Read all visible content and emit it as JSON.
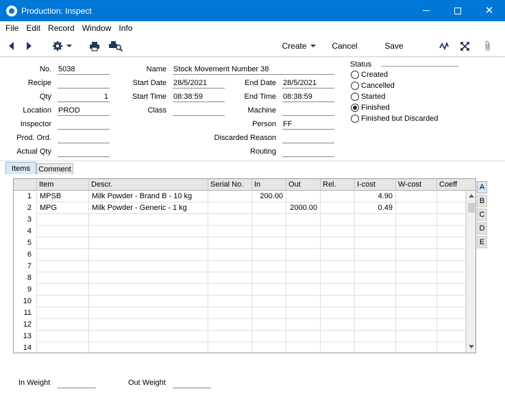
{
  "window": {
    "title": "Production: Inspect"
  },
  "menu": [
    "File",
    "Edit",
    "Record",
    "Window",
    "Info"
  ],
  "toolbar": {
    "create_label": "Create",
    "cancel_label": "Cancel",
    "save_label": "Save"
  },
  "header": {
    "labels": {
      "no": "No.",
      "recipe": "Recipe",
      "qty": "Qty",
      "location": "Location",
      "inspector": "Inspector",
      "prod_ord": "Prod. Ord.",
      "actual_qty": "Actual Qty",
      "name": "Name",
      "start_date": "Start Date",
      "start_time": "Start Time",
      "class": "Class",
      "end_date": "End Date",
      "end_time": "End Time",
      "machine": "Machine",
      "person": "Person",
      "discarded_reason": "Discarded Reason",
      "routing": "Routing",
      "status": "Status"
    },
    "values": {
      "no": "5038",
      "recipe": "",
      "qty": "1",
      "location": "PROD",
      "inspector": "",
      "prod_ord": "",
      "actual_qty": "",
      "name": "Stock Movement Number 38",
      "start_date": "28/5/2021",
      "start_time": "08:38:59",
      "class": "",
      "end_date": "28/5/2021",
      "end_time": "08:38:59",
      "machine": "",
      "person": "FF",
      "discarded_reason": "",
      "routing": ""
    },
    "status_options": [
      "Created",
      "Cancelled",
      "Started",
      "Finished",
      "Finished but Discarded"
    ],
    "status_selected": "Finished"
  },
  "tabs": [
    "Items",
    "Comment"
  ],
  "grid": {
    "columns": [
      "Item",
      "Descr.",
      "Serial No.",
      "In",
      "Out",
      "Rel.",
      "I-cost",
      "W-cost",
      "Coeff"
    ],
    "rows": [
      {
        "n": "1",
        "item": "MPSB",
        "descr": "Milk Powder - Brand B - 10 kg",
        "serial": "",
        "in": "200.00",
        "out": "",
        "rel": "",
        "icost": "4.90",
        "wcost": "",
        "coeff": ""
      },
      {
        "n": "2",
        "item": "MPG",
        "descr": "Milk Powder - Generic - 1 kg",
        "serial": "",
        "in": "",
        "out": "2000.00",
        "rel": "",
        "icost": "0.49",
        "wcost": "",
        "coeff": ""
      },
      {
        "n": "3"
      },
      {
        "n": "4"
      },
      {
        "n": "5"
      },
      {
        "n": "6"
      },
      {
        "n": "7"
      },
      {
        "n": "8"
      },
      {
        "n": "9"
      },
      {
        "n": "10"
      },
      {
        "n": "11"
      },
      {
        "n": "12"
      },
      {
        "n": "13"
      },
      {
        "n": "14"
      }
    ]
  },
  "side_tabs": [
    "A",
    "B",
    "C",
    "D",
    "E"
  ],
  "footer": {
    "in_weight_label": "In Weight",
    "in_weight": "",
    "out_weight_label": "Out Weight",
    "out_weight": ""
  }
}
